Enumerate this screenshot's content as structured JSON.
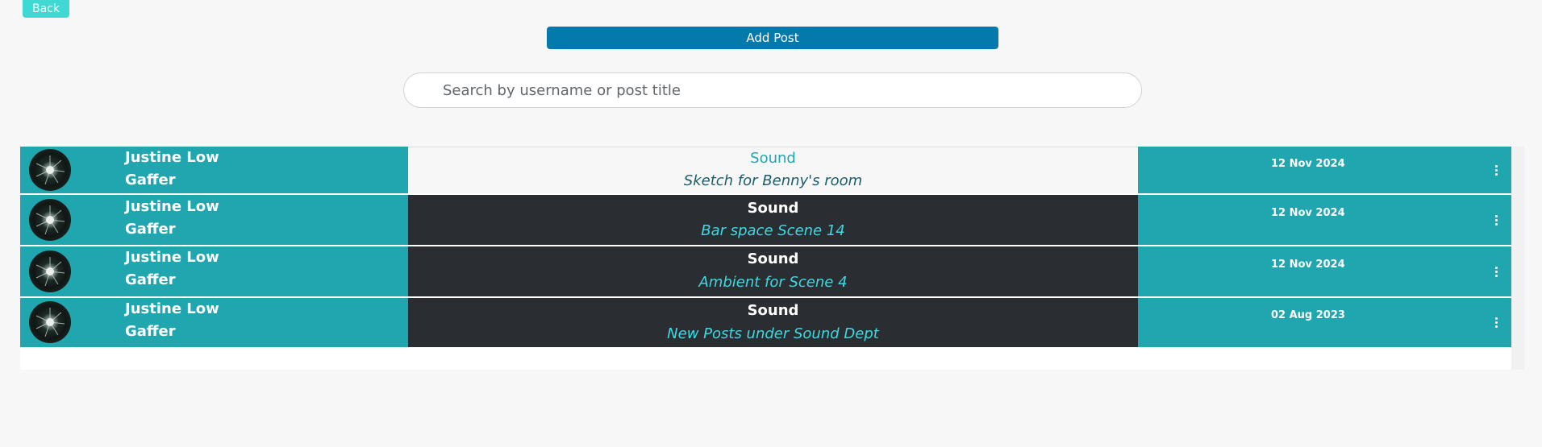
{
  "header": {
    "back_label": "Back",
    "add_post_label": "Add Post"
  },
  "search": {
    "placeholder": "Search by username or post title",
    "value": ""
  },
  "colors": {
    "accent_teal": "#20a6ae",
    "back_button": "#3fd8d2",
    "add_post_button": "#0479ac",
    "dark_cell": "#2a2e32"
  },
  "posts": [
    {
      "user_name": "Justine Low",
      "user_role": "Gaffer",
      "department": "Sound",
      "title": "Sketch for Benny's room",
      "date": "12 Nov 2024",
      "avatar_icon": "avatar-image",
      "menu_icon": "kebab-menu-icon"
    },
    {
      "user_name": "Justine Low",
      "user_role": "Gaffer",
      "department": "Sound",
      "title": "Bar space Scene 14",
      "date": "12 Nov 2024",
      "avatar_icon": "avatar-image",
      "menu_icon": "kebab-menu-icon"
    },
    {
      "user_name": "Justine Low",
      "user_role": "Gaffer",
      "department": "Sound",
      "title": "Ambient for Scene 4",
      "date": "12 Nov 2024",
      "avatar_icon": "avatar-image",
      "menu_icon": "kebab-menu-icon"
    },
    {
      "user_name": "Justine Low",
      "user_role": "Gaffer",
      "department": "Sound",
      "title": "New Posts under Sound Dept",
      "date": "02 Aug 2023",
      "avatar_icon": "avatar-image",
      "menu_icon": "kebab-menu-icon"
    }
  ]
}
